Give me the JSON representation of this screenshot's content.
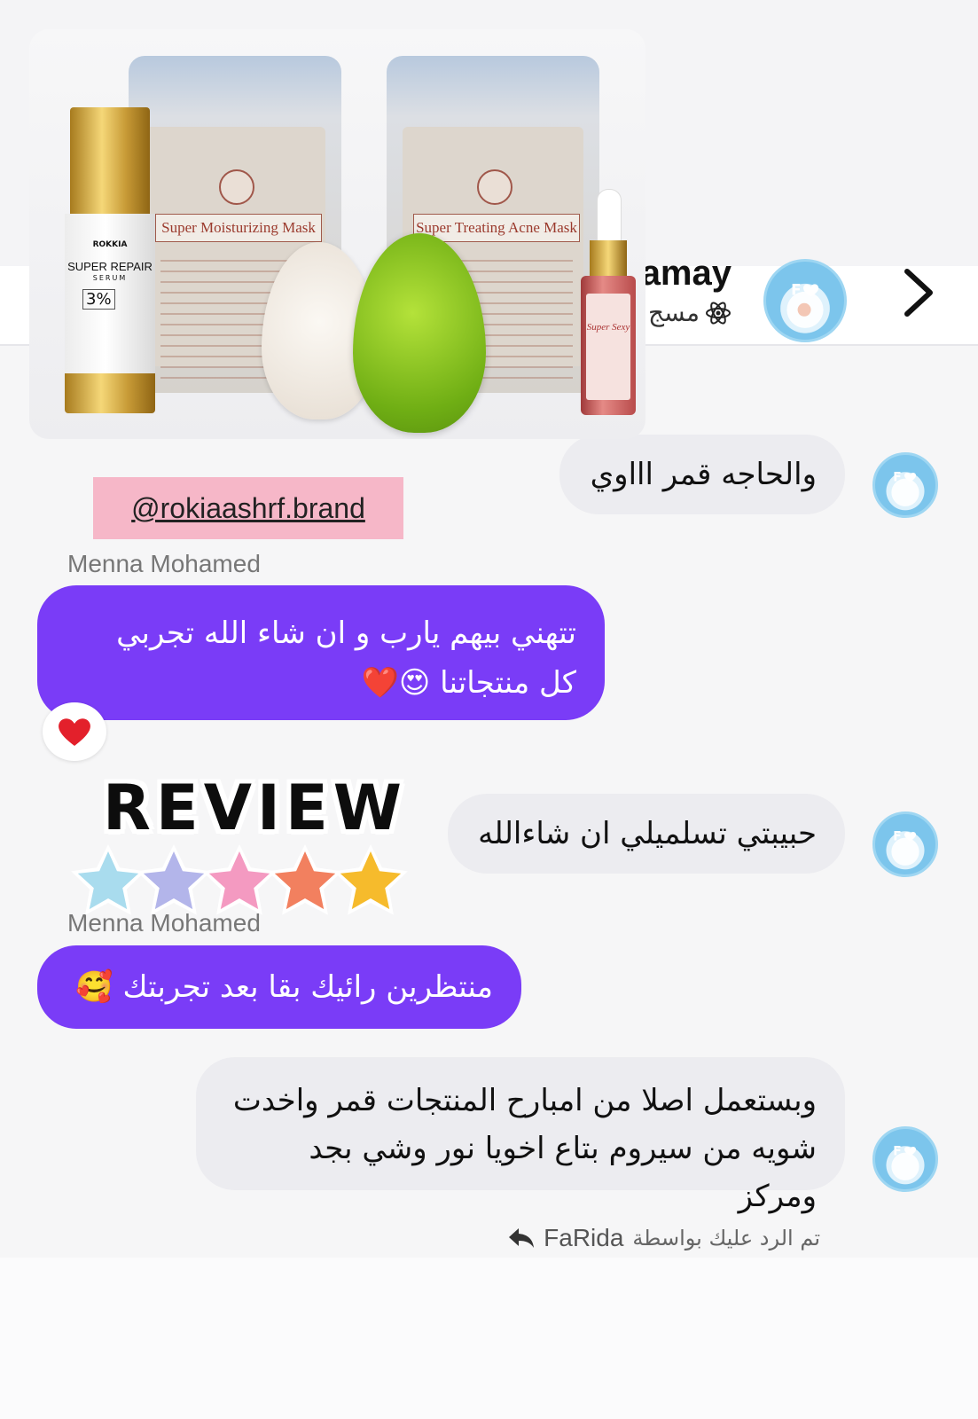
{
  "header": {
    "name": "amay",
    "subtitle": "مسج",
    "avatar_icon": "profile-avatar",
    "chevron_icon": "chevron-right-icon"
  },
  "product_image": {
    "serum_brand": "ROKKIA",
    "serum_title": "SUPER REPAIR",
    "serum_sub": "SERUM",
    "serum_percent": "3%",
    "pouch_left_label": "Super Moisturizing Mask",
    "pouch_right_label": "Super Treating Acne Mask",
    "dropper_label": "Super Sexy"
  },
  "mention": "@rokiaashrf.brand",
  "messages": [
    {
      "side": "in",
      "text": "والحاجه قمر اااوي"
    },
    {
      "side": "out",
      "sender": "Menna Mohamed",
      "text": "تتهني بيهم يارب و ان شاء الله تجربي كل منتجاتنا 😍❤️"
    },
    {
      "side": "in",
      "text": "حبيبتي تسلميلي ان شاءالله"
    },
    {
      "side": "out",
      "sender": "Menna Mohamed",
      "text": "منتظرين رائيك بقا بعد تجربتك 🥰"
    },
    {
      "side": "in",
      "text": "وبستعمل اصلا من امبارح المنتجات قمر واخدت شويه من سيروم بتاع اخويا نور وشي بجد ومركز"
    }
  ],
  "reaction": "❤️",
  "sticker": {
    "word": "REVIEW",
    "star_colors": [
      "#a9dcee",
      "#b3b5ea",
      "#f49ac1",
      "#f2805f",
      "#f6bb2c"
    ]
  },
  "footer": {
    "replied_by": "تم الرد عليك بواسطة",
    "replier": "FaRida",
    "reply_icon": "reply-arrow-icon"
  },
  "colors": {
    "accent_out": "#7a3cf7",
    "bubble_in": "#ececf0",
    "mention_bg": "#f6b7c8"
  }
}
